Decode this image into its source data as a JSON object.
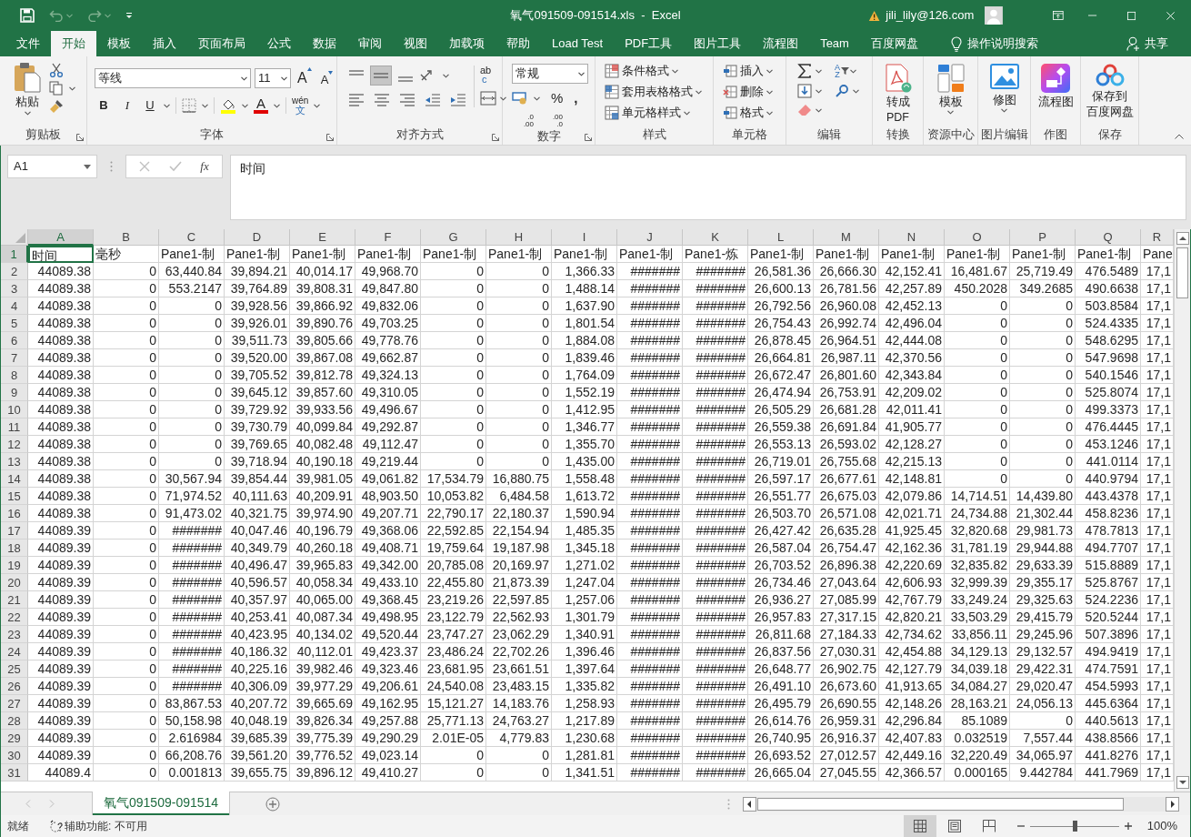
{
  "title_bar": {
    "title": "氧气091509-091514.xls  -  Excel",
    "account": "jili_lily@126.com"
  },
  "ribbon_tabs": [
    {
      "label": "文件",
      "selected": false
    },
    {
      "label": "开始",
      "selected": true
    },
    {
      "label": "模板",
      "selected": false
    },
    {
      "label": "插入",
      "selected": false
    },
    {
      "label": "页面布局",
      "selected": false
    },
    {
      "label": "公式",
      "selected": false
    },
    {
      "label": "数据",
      "selected": false
    },
    {
      "label": "审阅",
      "selected": false
    },
    {
      "label": "视图",
      "selected": false
    },
    {
      "label": "加载项",
      "selected": false
    },
    {
      "label": "帮助",
      "selected": false
    },
    {
      "label": "Load Test",
      "selected": false
    },
    {
      "label": "PDF工具",
      "selected": false
    },
    {
      "label": "图片工具",
      "selected": false
    },
    {
      "label": "流程图",
      "selected": false
    },
    {
      "label": "Team",
      "selected": false
    },
    {
      "label": "百度网盘",
      "selected": false
    }
  ],
  "tell_me": "操作说明搜索",
  "share": "共享",
  "ribbon_groups": [
    {
      "kind": "clipboard",
      "label": "剪贴板",
      "launcher": true,
      "paste": "粘贴"
    },
    {
      "kind": "font",
      "label": "字体",
      "launcher": true,
      "font": "等线",
      "size": "11",
      "grow": "A",
      "shrink": "A",
      "bold": "B",
      "italic": "I",
      "underline": "U",
      "font_color": "A",
      "phonetic": [
        "wén",
        "文"
      ]
    },
    {
      "kind": "alignment",
      "label": "对齐方式",
      "launcher": true,
      "wrap": [
        "ab",
        "c"
      ]
    },
    {
      "kind": "number",
      "label": "数字",
      "launcher": true,
      "format": "常规",
      "percent": "%",
      "comma": ",",
      "decimals": [
        {
          "top": ".0",
          "bottom": ".00"
        },
        {
          "top": ".00",
          "bottom": ".0"
        }
      ]
    },
    {
      "kind": "styles",
      "label": "样式",
      "launcher": false,
      "commands": [
        "条件格式",
        "套用表格格式",
        "单元格样式"
      ]
    },
    {
      "kind": "cells",
      "label": "单元格",
      "launcher": false,
      "commands": [
        "插入",
        "删除",
        "格式"
      ]
    },
    {
      "kind": "editing",
      "label": "编辑",
      "launcher": false,
      "sort": [
        "A",
        "Z"
      ]
    },
    {
      "kind": "convert",
      "label": "转换",
      "launcher": false,
      "button": [
        "转成",
        "PDF"
      ]
    },
    {
      "kind": "template",
      "label": "资源中心",
      "launcher": false,
      "button": [
        "模板"
      ]
    },
    {
      "kind": "picture",
      "label": "图片编辑",
      "launcher": false,
      "button": [
        "修图"
      ]
    },
    {
      "kind": "flowchart",
      "label": "作图",
      "launcher": false,
      "button": [
        "流程图"
      ]
    },
    {
      "kind": "baidu",
      "label": "保存",
      "launcher": false,
      "button": [
        "保存到",
        "百度网盘"
      ]
    }
  ],
  "formula_bar": {
    "name_box": "A1",
    "function_label": "fx",
    "content": "时间"
  },
  "sheet": {
    "columns": [
      {
        "label": "A",
        "selected": true
      },
      {
        "label": "B",
        "selected": false
      },
      {
        "label": "C",
        "selected": false
      },
      {
        "label": "D",
        "selected": false
      },
      {
        "label": "E",
        "selected": false
      },
      {
        "label": "F",
        "selected": false
      },
      {
        "label": "G",
        "selected": false
      },
      {
        "label": "H",
        "selected": false
      },
      {
        "label": "I",
        "selected": false
      },
      {
        "label": "J",
        "selected": false
      },
      {
        "label": "K",
        "selected": false
      },
      {
        "label": "L",
        "selected": false
      },
      {
        "label": "M",
        "selected": false
      },
      {
        "label": "N",
        "selected": false
      },
      {
        "label": "O",
        "selected": false
      },
      {
        "label": "P",
        "selected": false
      },
      {
        "label": "Q",
        "selected": false
      },
      {
        "label": "R",
        "selected": false
      }
    ],
    "rows": [
      {
        "n": "1",
        "selected": true,
        "kind": "text",
        "cells": [
          "时间",
          "毫秒",
          "Pane1-制",
          "Pane1-制",
          "Pane1-制",
          "Pane1-制",
          "Pane1-制",
          "Pane1-制",
          "Pane1-制",
          "Pane1-制",
          "Pane1-炼",
          "Pane1-制",
          "Pane1-制",
          "Pane1-制",
          "Pane1-制",
          "Pane1-制",
          "Pane1-制",
          "Pane"
        ]
      },
      {
        "n": "2",
        "selected": false,
        "kind": "number",
        "cells": [
          "44089.38",
          "0",
          "63,440.84",
          "39,894.21",
          "40,014.17",
          "49,968.70",
          "0",
          "0",
          "1,366.33",
          "#######",
          "#######",
          "26,581.36",
          "26,666.30",
          "42,152.41",
          "16,481.67",
          "25,719.49",
          "476.5489",
          "17,1"
        ]
      },
      {
        "n": "3",
        "selected": false,
        "kind": "number",
        "cells": [
          "44089.38",
          "0",
          "553.2147",
          "39,764.89",
          "39,808.31",
          "49,847.80",
          "0",
          "0",
          "1,488.14",
          "#######",
          "#######",
          "26,600.13",
          "26,781.56",
          "42,257.89",
          "450.2028",
          "349.2685",
          "490.6638",
          "17,1"
        ]
      },
      {
        "n": "4",
        "selected": false,
        "kind": "number",
        "cells": [
          "44089.38",
          "0",
          "0",
          "39,928.56",
          "39,866.92",
          "49,832.06",
          "0",
          "0",
          "1,637.90",
          "#######",
          "#######",
          "26,792.56",
          "26,960.08",
          "42,452.13",
          "0",
          "0",
          "503.8584",
          "17,1"
        ]
      },
      {
        "n": "5",
        "selected": false,
        "kind": "number",
        "cells": [
          "44089.38",
          "0",
          "0",
          "39,926.01",
          "39,890.76",
          "49,703.25",
          "0",
          "0",
          "1,801.54",
          "#######",
          "#######",
          "26,754.43",
          "26,992.74",
          "42,496.04",
          "0",
          "0",
          "524.4335",
          "17,1"
        ]
      },
      {
        "n": "6",
        "selected": false,
        "kind": "number",
        "cells": [
          "44089.38",
          "0",
          "0",
          "39,511.73",
          "39,805.66",
          "49,778.76",
          "0",
          "0",
          "1,884.08",
          "#######",
          "#######",
          "26,878.45",
          "26,964.51",
          "42,444.08",
          "0",
          "0",
          "548.6295",
          "17,1"
        ]
      },
      {
        "n": "7",
        "selected": false,
        "kind": "number",
        "cells": [
          "44089.38",
          "0",
          "0",
          "39,520.00",
          "39,867.08",
          "49,662.87",
          "0",
          "0",
          "1,839.46",
          "#######",
          "#######",
          "26,664.81",
          "26,987.11",
          "42,370.56",
          "0",
          "0",
          "547.9698",
          "17,1"
        ]
      },
      {
        "n": "8",
        "selected": false,
        "kind": "number",
        "cells": [
          "44089.38",
          "0",
          "0",
          "39,705.52",
          "39,812.78",
          "49,324.13",
          "0",
          "0",
          "1,764.09",
          "#######",
          "#######",
          "26,672.47",
          "26,801.60",
          "42,343.84",
          "0",
          "0",
          "540.1546",
          "17,1"
        ]
      },
      {
        "n": "9",
        "selected": false,
        "kind": "number",
        "cells": [
          "44089.38",
          "0",
          "0",
          "39,645.12",
          "39,857.60",
          "49,310.05",
          "0",
          "0",
          "1,552.19",
          "#######",
          "#######",
          "26,474.94",
          "26,753.91",
          "42,209.02",
          "0",
          "0",
          "525.8074",
          "17,1"
        ]
      },
      {
        "n": "10",
        "selected": false,
        "kind": "number",
        "cells": [
          "44089.38",
          "0",
          "0",
          "39,729.92",
          "39,933.56",
          "49,496.67",
          "0",
          "0",
          "1,412.95",
          "#######",
          "#######",
          "26,505.29",
          "26,681.28",
          "42,011.41",
          "0",
          "0",
          "499.3373",
          "17,1"
        ]
      },
      {
        "n": "11",
        "selected": false,
        "kind": "number",
        "cells": [
          "44089.38",
          "0",
          "0",
          "39,730.79",
          "40,099.84",
          "49,292.87",
          "0",
          "0",
          "1,346.77",
          "#######",
          "#######",
          "26,559.38",
          "26,691.84",
          "41,905.77",
          "0",
          "0",
          "476.4445",
          "17,1"
        ]
      },
      {
        "n": "12",
        "selected": false,
        "kind": "number",
        "cells": [
          "44089.38",
          "0",
          "0",
          "39,769.65",
          "40,082.48",
          "49,112.47",
          "0",
          "0",
          "1,355.70",
          "#######",
          "#######",
          "26,553.13",
          "26,593.02",
          "42,128.27",
          "0",
          "0",
          "453.1246",
          "17,1"
        ]
      },
      {
        "n": "13",
        "selected": false,
        "kind": "number",
        "cells": [
          "44089.38",
          "0",
          "0",
          "39,718.94",
          "40,190.18",
          "49,219.44",
          "0",
          "0",
          "1,435.00",
          "#######",
          "#######",
          "26,719.01",
          "26,755.68",
          "42,215.13",
          "0",
          "0",
          "441.0114",
          "17,1"
        ]
      },
      {
        "n": "14",
        "selected": false,
        "kind": "number",
        "cells": [
          "44089.38",
          "0",
          "30,567.94",
          "39,854.44",
          "39,981.05",
          "49,061.82",
          "17,534.79",
          "16,880.75",
          "1,558.48",
          "#######",
          "#######",
          "26,597.17",
          "26,677.61",
          "42,148.81",
          "0",
          "0",
          "440.9794",
          "17,1"
        ]
      },
      {
        "n": "15",
        "selected": false,
        "kind": "number",
        "cells": [
          "44089.38",
          "0",
          "71,974.52",
          "40,111.63",
          "40,209.91",
          "48,903.50",
          "10,053.82",
          "6,484.58",
          "1,613.72",
          "#######",
          "#######",
          "26,551.77",
          "26,675.03",
          "42,079.86",
          "14,714.51",
          "14,439.80",
          "443.4378",
          "17,1"
        ]
      },
      {
        "n": "16",
        "selected": false,
        "kind": "number",
        "cells": [
          "44089.38",
          "0",
          "91,473.02",
          "40,321.75",
          "39,974.90",
          "49,207.71",
          "22,790.17",
          "22,180.37",
          "1,590.94",
          "#######",
          "#######",
          "26,503.70",
          "26,571.08",
          "42,021.71",
          "24,734.88",
          "21,302.44",
          "458.8236",
          "17,1"
        ]
      },
      {
        "n": "17",
        "selected": false,
        "kind": "number",
        "cells": [
          "44089.39",
          "0",
          "#######",
          "40,047.46",
          "40,196.79",
          "49,368.06",
          "22,592.85",
          "22,154.94",
          "1,485.35",
          "#######",
          "#######",
          "26,427.42",
          "26,635.28",
          "41,925.45",
          "32,820.68",
          "29,981.73",
          "478.7813",
          "17,1"
        ]
      },
      {
        "n": "18",
        "selected": false,
        "kind": "number",
        "cells": [
          "44089.39",
          "0",
          "#######",
          "40,349.79",
          "40,260.18",
          "49,408.71",
          "19,759.64",
          "19,187.98",
          "1,345.18",
          "#######",
          "#######",
          "26,587.04",
          "26,754.47",
          "42,162.36",
          "31,781.19",
          "29,944.88",
          "494.7707",
          "17,1"
        ]
      },
      {
        "n": "19",
        "selected": false,
        "kind": "number",
        "cells": [
          "44089.39",
          "0",
          "#######",
          "40,496.47",
          "39,965.83",
          "49,342.00",
          "20,785.08",
          "20,169.97",
          "1,271.02",
          "#######",
          "#######",
          "26,703.52",
          "26,896.38",
          "42,220.69",
          "32,835.82",
          "29,633.39",
          "515.8889",
          "17,1"
        ]
      },
      {
        "n": "20",
        "selected": false,
        "kind": "number",
        "cells": [
          "44089.39",
          "0",
          "#######",
          "40,596.57",
          "40,058.34",
          "49,433.10",
          "22,455.80",
          "21,873.39",
          "1,247.04",
          "#######",
          "#######",
          "26,734.46",
          "27,043.64",
          "42,606.93",
          "32,999.39",
          "29,355.17",
          "525.8767",
          "17,1"
        ]
      },
      {
        "n": "21",
        "selected": false,
        "kind": "number",
        "cells": [
          "44089.39",
          "0",
          "#######",
          "40,357.97",
          "40,065.00",
          "49,368.45",
          "23,219.26",
          "22,597.85",
          "1,257.06",
          "#######",
          "#######",
          "26,936.27",
          "27,085.99",
          "42,767.79",
          "33,249.24",
          "29,325.63",
          "524.2236",
          "17,1"
        ]
      },
      {
        "n": "22",
        "selected": false,
        "kind": "number",
        "cells": [
          "44089.39",
          "0",
          "#######",
          "40,253.41",
          "40,087.34",
          "49,498.95",
          "23,122.79",
          "22,562.93",
          "1,301.79",
          "#######",
          "#######",
          "26,957.83",
          "27,317.15",
          "42,820.21",
          "33,503.29",
          "29,415.79",
          "520.5244",
          "17,1"
        ]
      },
      {
        "n": "23",
        "selected": false,
        "kind": "number",
        "cells": [
          "44089.39",
          "0",
          "#######",
          "40,423.95",
          "40,134.02",
          "49,520.44",
          "23,747.27",
          "23,062.29",
          "1,340.91",
          "#######",
          "#######",
          "26,811.68",
          "27,184.33",
          "42,734.62",
          "33,856.11",
          "29,245.96",
          "507.3896",
          "17,1"
        ]
      },
      {
        "n": "24",
        "selected": false,
        "kind": "number",
        "cells": [
          "44089.39",
          "0",
          "#######",
          "40,186.32",
          "40,112.01",
          "49,423.37",
          "23,486.24",
          "22,702.26",
          "1,396.46",
          "#######",
          "#######",
          "26,837.56",
          "27,030.31",
          "42,454.88",
          "34,129.13",
          "29,132.57",
          "494.9419",
          "17,1"
        ]
      },
      {
        "n": "25",
        "selected": false,
        "kind": "number",
        "cells": [
          "44089.39",
          "0",
          "#######",
          "40,225.16",
          "39,982.46",
          "49,323.46",
          "23,681.95",
          "23,661.51",
          "1,397.64",
          "#######",
          "#######",
          "26,648.77",
          "26,902.75",
          "42,127.79",
          "34,039.18",
          "29,422.31",
          "474.7591",
          "17,1"
        ]
      },
      {
        "n": "26",
        "selected": false,
        "kind": "number",
        "cells": [
          "44089.39",
          "0",
          "#######",
          "40,306.09",
          "39,977.29",
          "49,206.61",
          "24,540.08",
          "23,483.15",
          "1,335.82",
          "#######",
          "#######",
          "26,491.10",
          "26,673.60",
          "41,913.65",
          "34,084.27",
          "29,020.47",
          "454.5993",
          "17,1"
        ]
      },
      {
        "n": "27",
        "selected": false,
        "kind": "number",
        "cells": [
          "44089.39",
          "0",
          "83,867.53",
          "40,207.72",
          "39,665.69",
          "49,162.95",
          "15,121.27",
          "14,183.76",
          "1,258.93",
          "#######",
          "#######",
          "26,495.79",
          "26,690.55",
          "42,148.26",
          "28,163.21",
          "24,056.13",
          "445.6364",
          "17,1"
        ]
      },
      {
        "n": "28",
        "selected": false,
        "kind": "number",
        "cells": [
          "44089.39",
          "0",
          "50,158.98",
          "40,048.19",
          "39,826.34",
          "49,257.88",
          "25,771.13",
          "24,763.27",
          "1,217.89",
          "#######",
          "#######",
          "26,614.76",
          "26,959.31",
          "42,296.84",
          "85.1089",
          "0",
          "440.5613",
          "17,1"
        ]
      },
      {
        "n": "29",
        "selected": false,
        "kind": "number",
        "cells": [
          "44089.39",
          "0",
          "2.616984",
          "39,685.39",
          "39,775.39",
          "49,290.29",
          "2.01E-05",
          "4,779.83",
          "1,230.68",
          "#######",
          "#######",
          "26,740.95",
          "26,916.37",
          "42,407.83",
          "0.032519",
          "7,557.44",
          "438.8566",
          "17,1"
        ]
      },
      {
        "n": "30",
        "selected": false,
        "kind": "number",
        "cells": [
          "44089.39",
          "0",
          "66,208.76",
          "39,561.20",
          "39,776.52",
          "49,023.14",
          "0",
          "0",
          "1,281.81",
          "#######",
          "#######",
          "26,693.52",
          "27,012.57",
          "42,449.16",
          "32,220.49",
          "34,065.97",
          "441.8276",
          "17,1"
        ]
      },
      {
        "n": "31",
        "selected": false,
        "kind": "number",
        "cells": [
          "44089.4",
          "0",
          "0.001813",
          "39,655.75",
          "39,896.12",
          "49,410.27",
          "0",
          "0",
          "1,341.51",
          "#######",
          "#######",
          "26,665.04",
          "27,045.55",
          "42,366.57",
          "0.000165",
          "9.442784",
          "441.7969",
          "17,1"
        ]
      }
    ]
  },
  "sheet_tabs": [
    {
      "label": "氧气091509-091514",
      "selected": true
    }
  ],
  "status_bar": {
    "ready": "就绪",
    "accessibility": "辅助功能: 不可用",
    "views": [
      {
        "kind": "normal",
        "selected": true
      },
      {
        "kind": "page_layout",
        "selected": false
      },
      {
        "kind": "page_break",
        "selected": false
      }
    ],
    "zoom": {
      "level": 0.5,
      "reading": "100%"
    }
  }
}
